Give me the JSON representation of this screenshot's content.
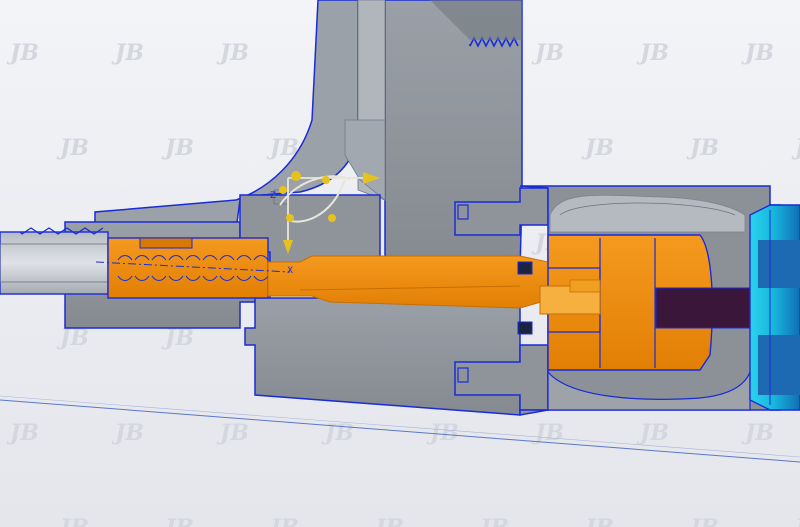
{
  "viewport": {
    "background_color": "#eceef2",
    "watermark_text": "JB"
  },
  "model": {
    "body_color": "#8f949b",
    "body_shadow_color": "#7d8289",
    "section_edge_color": "#1a2bd8",
    "core_color": "#f08c0a",
    "core_dark_color": "#c86e00",
    "cap_color": "#1ec8e6",
    "cap_dark_color": "#1269b4",
    "rod_color": "#3a163a",
    "tube_color": "#c7ccd3"
  },
  "triad": {
    "handle_color": "#e8c21c",
    "z_label": "Z",
    "x_label": "X",
    "icon": "csys-triad-icon"
  },
  "datum_line_color": "#5a78c8"
}
